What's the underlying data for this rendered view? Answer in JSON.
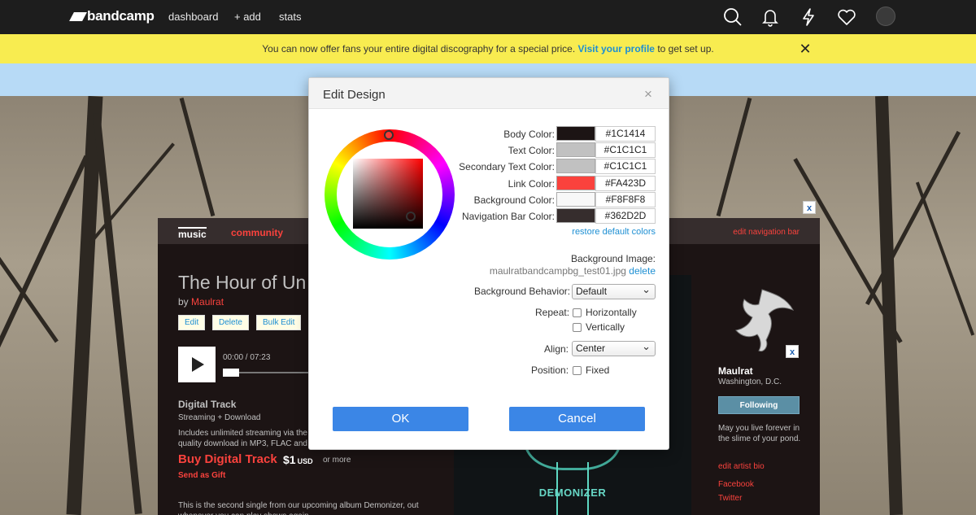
{
  "topnav": {
    "logo": "bandcamp",
    "links": [
      "dashboard",
      "+ add",
      "stats"
    ],
    "icons": [
      "search-icon",
      "bell-icon",
      "lightning-icon",
      "heart-icon",
      "avatar"
    ]
  },
  "banner": {
    "text_before": "You can now offer fans your entire digital discography for a special price.",
    "link": "Visit your profile",
    "text_after": "to get set up.",
    "close": "✕"
  },
  "page": {
    "nav": {
      "music": "music",
      "community": "community",
      "edit_nav": "edit navigation bar"
    },
    "title": "The Hour of Un",
    "by": "by",
    "artist": "Maulrat",
    "buttons": {
      "edit": "Edit",
      "delete": "Delete",
      "bulk_edit": "Bulk Edit"
    },
    "player": {
      "time": "00:00 / 07:23"
    },
    "digital_track": {
      "heading": "Digital Track",
      "sub": "Streaming + Download",
      "desc": "Includes unlimited streaming via the quality download in MP3, FLAC and",
      "buy": "Buy Digital Track",
      "price": "$1",
      "currency": "USD",
      "or_more": "or more",
      "gift": "Send as Gift"
    },
    "about": "This is the second single from our upcoming album Demonizer, out whenever you can play shows again.",
    "art_text": "DEMONIZER",
    "close_x": "x",
    "sidebar": {
      "name": "Maulrat",
      "location": "Washington, D.C.",
      "follow": "Following",
      "bio": "May you live forever in the slime of your pond.",
      "edit_bio": "edit artist bio",
      "facebook": "Facebook",
      "twitter": "Twitter"
    }
  },
  "modal": {
    "title": "Edit Design",
    "close": "×",
    "colors": [
      {
        "label": "Body Color:",
        "hex": "#1C1414",
        "swatch": "#1c1414"
      },
      {
        "label": "Text Color:",
        "hex": "#C1C1C1",
        "swatch": "#c1c1c1"
      },
      {
        "label": "Secondary Text Color:",
        "hex": "#C1C1C1",
        "swatch": "#c1c1c1"
      },
      {
        "label": "Link Color:",
        "hex": "#FA423D",
        "swatch": "#fa423d"
      },
      {
        "label": "Background Color:",
        "hex": "#F8F8F8",
        "swatch": "#f8f8f8"
      },
      {
        "label": "Navigation Bar Color:",
        "hex": "#362D2D",
        "swatch": "#362d2d"
      }
    ],
    "restore": "restore default colors",
    "bg_image_label": "Background Image:",
    "bg_image_file": "maulratbandcampbg_test01.jpg",
    "bg_image_delete": "delete",
    "bg_behavior_label": "Background Behavior:",
    "bg_behavior_value": "Default",
    "repeat_label": "Repeat:",
    "repeat_h": "Horizontally",
    "repeat_v": "Vertically",
    "align_label": "Align:",
    "align_value": "Center",
    "position_label": "Position:",
    "position_fixed": "Fixed",
    "ok": "OK",
    "cancel": "Cancel"
  }
}
